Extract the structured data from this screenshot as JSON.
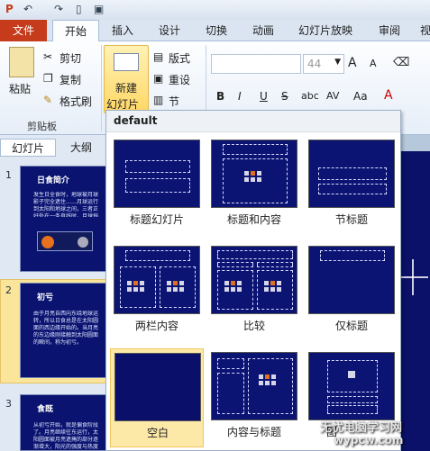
{
  "qat": {
    "icons": [
      "app-icon",
      "undo-icon",
      "redo-icon",
      "new-icon",
      "save-icon"
    ]
  },
  "tabs": [
    {
      "label": "文件"
    },
    {
      "label": "开始"
    },
    {
      "label": "插入"
    },
    {
      "label": "设计"
    },
    {
      "label": "切换"
    },
    {
      "label": "动画"
    },
    {
      "label": "幻灯片放映"
    },
    {
      "label": "审阅"
    },
    {
      "label": "视"
    }
  ],
  "ribbon": {
    "paste": "粘贴",
    "cut": "剪切",
    "copy": "复制",
    "format_painter": "格式刷",
    "clipboard_group": "剪贴板",
    "new_slide_1": "新建",
    "new_slide_2": "幻灯片",
    "layout": "版式",
    "reset": "重设",
    "section": "节",
    "font_size": "44",
    "bold": "B",
    "italic": "I",
    "underline": "U",
    "strike": "S",
    "shadow": "abc",
    "spacing": "AV",
    "case": "Aa",
    "grow": "A",
    "shrink": "A"
  },
  "left_pane": {
    "tab_slides": "幻灯片",
    "tab_outline": "大纲",
    "slides": [
      {
        "num": "1",
        "title": "日食简介",
        "body": "发生日全食时，地球被月球影子完全遮住……月球运行到太阳和地球之间，三者正好处在一条直线时，月球挡住了太阳射向地球的光。"
      },
      {
        "num": "2",
        "title": "初亏",
        "body": "由于月亮自西向东绕地球运转，所以日食总是在太阳圆面的西边缘开始的。当月亮的东边缘刚接触到太阳圆面的瞬间，称为初亏。"
      },
      {
        "num": "3",
        "title": "食既",
        "body": "从初亏开始，就是偏食阶段了。月亮继续往东运行，太阳圆面被月亮遮掩的部分逐渐增大，阳光的强度与热度显著下降。"
      }
    ]
  },
  "layout_menu": {
    "header": "default",
    "layouts": [
      {
        "label": "标题幻灯片"
      },
      {
        "label": "标题和内容"
      },
      {
        "label": "节标题"
      },
      {
        "label": "两栏内容"
      },
      {
        "label": "比较"
      },
      {
        "label": "仅标题"
      },
      {
        "label": "空白"
      },
      {
        "label": "内容与标题"
      },
      {
        "label": "图"
      }
    ]
  },
  "watermark": {
    "line1": "无忧电脑学习网",
    "line2": "wypcw.com"
  },
  "colors": {
    "file_tab": "#c63b1b",
    "slide_bg": "#0b1373",
    "selection": "#fde9a7"
  }
}
